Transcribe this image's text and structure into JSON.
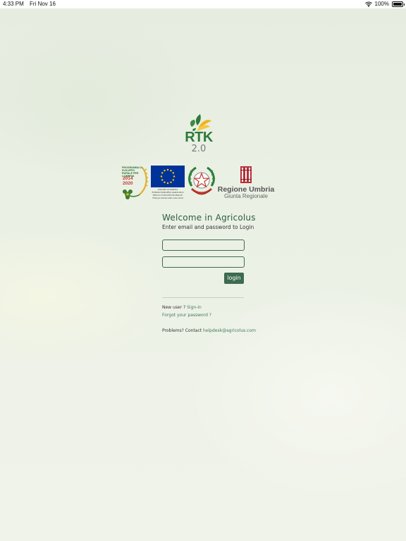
{
  "status_bar": {
    "time": "4:33 PM",
    "date": "Fri Nov 16",
    "battery": "100%",
    "wifi_icon": "wifi-icon",
    "battery_icon": "battery-icon"
  },
  "brand": {
    "name": "RTK",
    "version": "2.0",
    "primary_color": "#2c7a3a",
    "accent_color": "#f1b31c"
  },
  "partners": {
    "psr_text": "PROGRAMMA DI SVILUPPO RURALE PER L'UMBRIA",
    "psr_years_start": "2014",
    "psr_years_end": "2020",
    "eu_caption_1": "UNIONE EUROPEA",
    "eu_caption_2": "FONDO EUROPEO AGRICOLO",
    "eu_caption_3": "PER LO SVILUPPO RURALE:",
    "eu_caption_4": "l'Europa investe nelle zone rurali",
    "region_name": "Regione Umbria",
    "region_sub": "Giunta Regionale"
  },
  "login": {
    "title": "Welcome in Agricolus",
    "subtitle": "Enter email and password to Login",
    "email_value": "",
    "password_value": "",
    "button_label": "login",
    "button_color": "#3c6b50"
  },
  "links": {
    "new_user_text": "New user ?",
    "signup_label": "Sign-in",
    "forgot_label": "Forgot your password ?",
    "problems_text": "Problems? Contact",
    "helpdesk_email": "helpdesk@agricolus.com",
    "link_color": "#3f7a5a"
  }
}
